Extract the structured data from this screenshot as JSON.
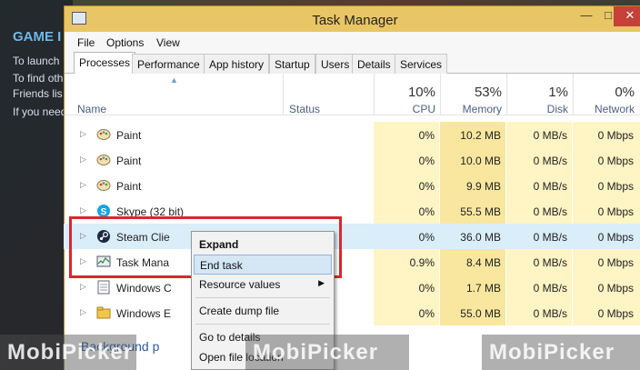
{
  "background": {
    "title": "GAME I",
    "lines": [
      "To launch",
      "To find oth",
      "Friends lis",
      "If you need"
    ]
  },
  "window": {
    "title": "Task Manager",
    "controls": {
      "minimize": "—",
      "maximize": "□",
      "close": "✕"
    }
  },
  "menu": [
    "File",
    "Options",
    "View"
  ],
  "tabs": [
    "Processes",
    "Performance",
    "App history",
    "Startup",
    "Users",
    "Details",
    "Services"
  ],
  "active_tab": "Processes",
  "columns": {
    "name": "Name",
    "status": "Status",
    "cpu": {
      "pct": "10%",
      "label": "CPU"
    },
    "memory": {
      "pct": "53%",
      "label": "Memory"
    },
    "disk": {
      "pct": "1%",
      "label": "Disk"
    },
    "network": {
      "pct": "0%",
      "label": "Network"
    }
  },
  "processes": [
    {
      "name": "Paint",
      "icon": "paint-icon",
      "cpu": "0%",
      "memory": "10.2 MB",
      "disk": "0 MB/s",
      "network": "0 Mbps"
    },
    {
      "name": "Paint",
      "icon": "paint-icon",
      "cpu": "0%",
      "memory": "10.0 MB",
      "disk": "0 MB/s",
      "network": "0 Mbps"
    },
    {
      "name": "Paint",
      "icon": "paint-icon",
      "cpu": "0%",
      "memory": "9.9 MB",
      "disk": "0 MB/s",
      "network": "0 Mbps"
    },
    {
      "name": "Skype (32 bit)",
      "icon": "skype-icon",
      "cpu": "0%",
      "memory": "55.5 MB",
      "disk": "0 MB/s",
      "network": "0 Mbps"
    },
    {
      "name": "Steam Clie",
      "icon": "steam-icon",
      "cpu": "0%",
      "memory": "36.0 MB",
      "disk": "0 MB/s",
      "network": "0 Mbps"
    },
    {
      "name": "Task Mana",
      "icon": "task-manager-icon",
      "cpu": "0.9%",
      "memory": "8.4 MB",
      "disk": "0 MB/s",
      "network": "0 Mbps"
    },
    {
      "name": "Windows C",
      "icon": "windows-app-icon",
      "cpu": "0%",
      "memory": "1.7 MB",
      "disk": "0 MB/s",
      "network": "0 Mbps"
    },
    {
      "name": "Windows E",
      "icon": "explorer-icon",
      "cpu": "0%",
      "memory": "55.0 MB",
      "disk": "0 MB/s",
      "network": "0 Mbps"
    }
  ],
  "section_title": "Background p",
  "context_menu": {
    "expand": "Expand",
    "end_task": "End task",
    "resource_values": "Resource values",
    "create_dump": "Create dump file",
    "go_to_details": "Go to details",
    "open_file_location": "Open file location"
  },
  "watermark": [
    "MobiPicker",
    "MobiPicker",
    "MobiPicker"
  ],
  "colors": {
    "titlebar": "#e8c565",
    "highlight": "#d8282e",
    "selected_row": "#d9eef9",
    "usage_cell": "#fff4c4"
  }
}
